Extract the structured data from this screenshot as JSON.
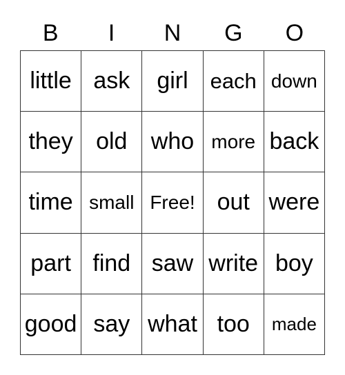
{
  "header": [
    "B",
    "I",
    "N",
    "G",
    "O"
  ],
  "cells": [
    [
      "little",
      "ask",
      "girl",
      "each",
      "down"
    ],
    [
      "they",
      "old",
      "who",
      "more",
      "back"
    ],
    [
      "time",
      "small",
      "Free!",
      "out",
      "were"
    ],
    [
      "part",
      "find",
      "saw",
      "write",
      "boy"
    ],
    [
      "good",
      "say",
      "what",
      "too",
      "made"
    ]
  ]
}
